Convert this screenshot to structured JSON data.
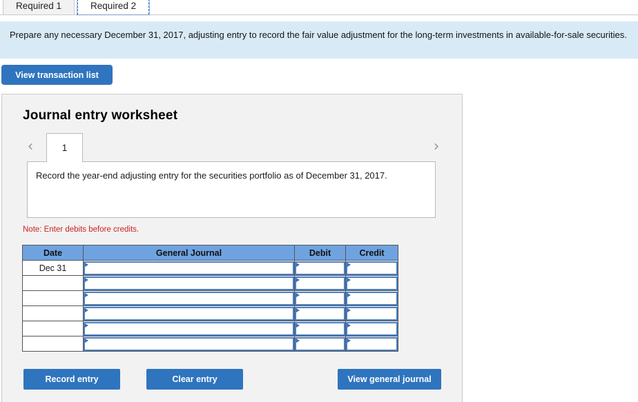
{
  "tabs": [
    {
      "label": "Required 1",
      "active": false
    },
    {
      "label": "Required 2",
      "active": true
    }
  ],
  "banner": {
    "text": "Prepare any necessary December 31, 2017, adjusting entry to record the fair value adjustment for the long-term investments in available-for-sale securities."
  },
  "toolbar": {
    "view_transaction_list_label": "View transaction list"
  },
  "worksheet": {
    "title": "Journal entry worksheet",
    "prev_icon": "chevron-left-icon",
    "next_icon": "chevron-right-icon",
    "sheet_tab_label": "1",
    "description": "Record the year-end adjusting entry for the securities portfolio as of December 31, 2017.",
    "note": "Note: Enter debits before credits."
  },
  "table": {
    "headers": [
      "Date",
      "General Journal",
      "Debit",
      "Credit"
    ],
    "rows": [
      {
        "date": "Dec 31",
        "general_journal": "",
        "debit": "",
        "credit": ""
      },
      {
        "date": "",
        "general_journal": "",
        "debit": "",
        "credit": ""
      },
      {
        "date": "",
        "general_journal": "",
        "debit": "",
        "credit": ""
      },
      {
        "date": "",
        "general_journal": "",
        "debit": "",
        "credit": ""
      },
      {
        "date": "",
        "general_journal": "",
        "debit": "",
        "credit": ""
      },
      {
        "date": "",
        "general_journal": "",
        "debit": "",
        "credit": ""
      }
    ]
  },
  "actions": {
    "record_entry_label": "Record entry",
    "clear_entry_label": "Clear entry",
    "view_general_journal_label": "View general journal"
  },
  "colors": {
    "button_blue": "#2f74be",
    "header_blue": "#6fa3e0",
    "banner_blue": "#d9eaf7",
    "panel_gray": "#f2f2f2",
    "note_red": "#cc2222",
    "input_border": "#4a7fc1"
  }
}
